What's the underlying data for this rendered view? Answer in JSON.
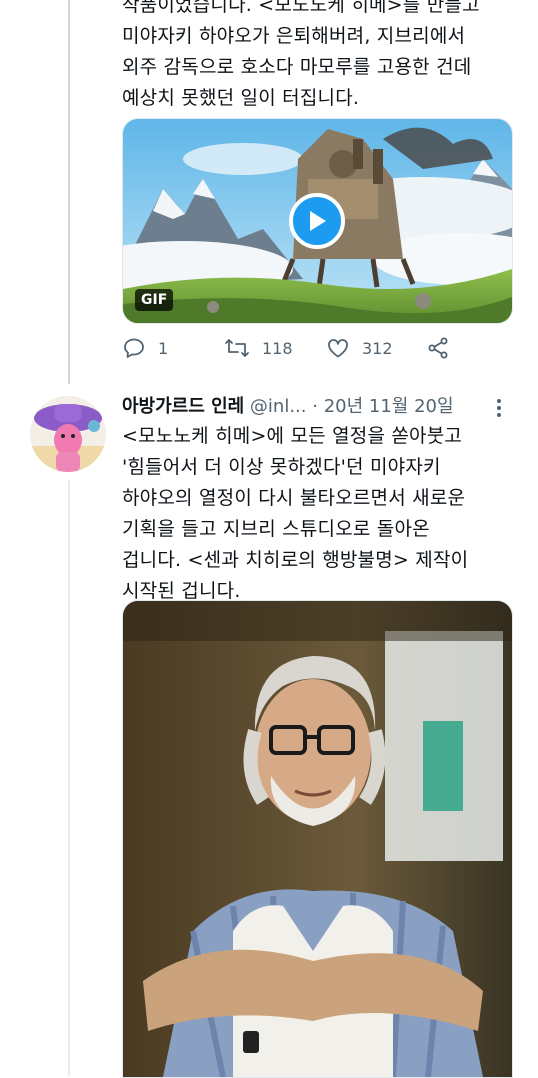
{
  "tweet1": {
    "text": "작품이었습니다. <모노노케 히메>를 만들고\n미야자키 하야오가 은퇴해버려, 지브리에서\n외주 감독으로 호소다 마모루를 고용한 건데\n예상치 못했던 일이 터집니다.",
    "media_badge": "GIF",
    "actions": {
      "replies": "1",
      "retweets": "118",
      "likes": "312"
    }
  },
  "tweet2": {
    "author_name": "아방가르드 인레",
    "author_handle": "@inl...",
    "separator": "·",
    "date": "20년 11월 20일",
    "text": "<모노노케 히메>에 모든 열정을 쏟아붓고\n'힘들어서 더 이상 못하겠다'던 미야자키\n하야오의 열정이 다시 불타오르면서 새로운\n기획을 들고 지브리 스튜디오로 돌아온\n겁니다. <센과 치히로의 행방불명> 제작이\n시작된 겁니다."
  },
  "colors": {
    "accent": "#1d9bf0",
    "muted": "#536471",
    "thread_line": "#cfd9de"
  },
  "icons": {
    "reply": "reply-icon",
    "retweet": "retweet-icon",
    "like": "like-icon",
    "share": "share-icon",
    "play": "play-icon",
    "more": "more-icon"
  }
}
